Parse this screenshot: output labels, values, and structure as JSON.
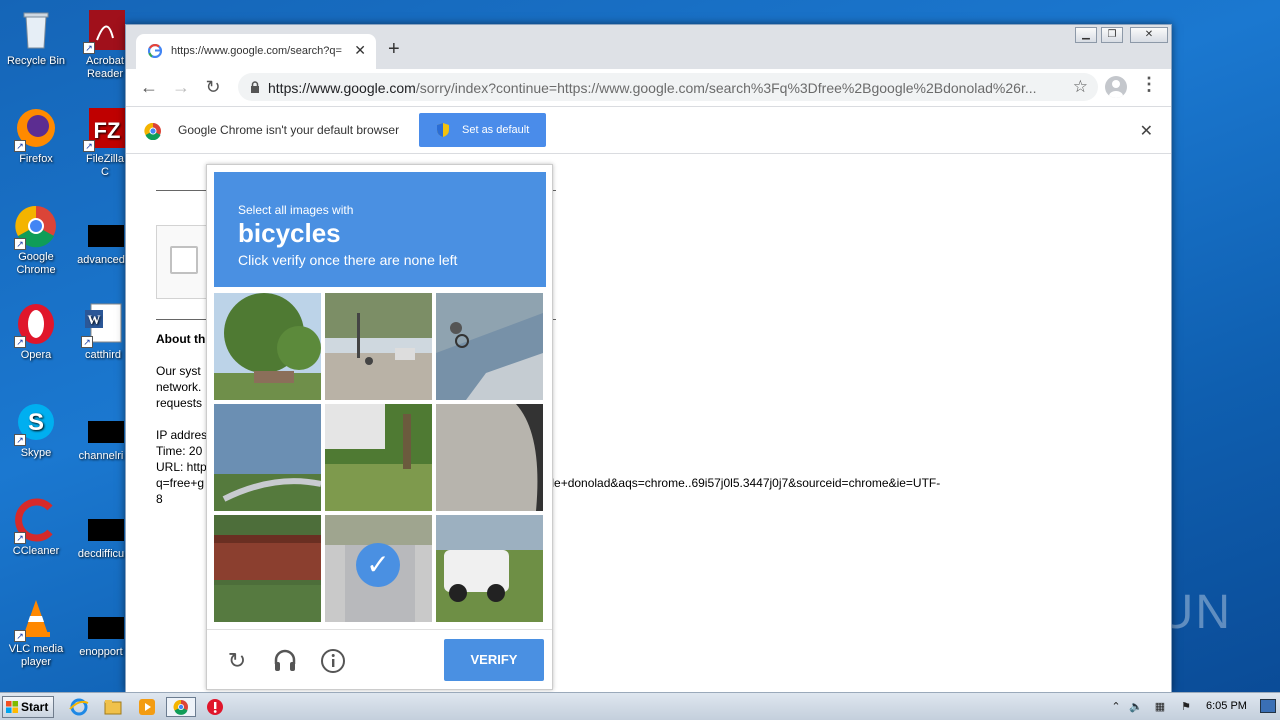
{
  "desktop": {
    "icons": [
      {
        "name": "recycle-bin",
        "label": "Recycle Bin"
      },
      {
        "name": "acrobat-reader",
        "label": "Acrobat Reader"
      },
      {
        "name": "firefox",
        "label": "Firefox"
      },
      {
        "name": "filezilla",
        "label": "FileZilla C"
      },
      {
        "name": "google-chrome",
        "label": "Google Chrome"
      },
      {
        "name": "advanced",
        "label": "advanced"
      },
      {
        "name": "opera",
        "label": "Opera"
      },
      {
        "name": "catthird",
        "label": "catthird"
      },
      {
        "name": "skype",
        "label": "Skype"
      },
      {
        "name": "channelri",
        "label": "channelri"
      },
      {
        "name": "ccleaner",
        "label": "CCleaner"
      },
      {
        "name": "decdifficu",
        "label": "decdifficu"
      },
      {
        "name": "vlc",
        "label": "VLC media player"
      },
      {
        "name": "enopport",
        "label": "enopport"
      }
    ],
    "watermark": "ANY ▷ RUN"
  },
  "browser": {
    "tab_title": "https://www.google.com/search?q=",
    "url_host": "https://www.google.com",
    "url_rest": "/sorry/index?continue=https://www.google.com/search%3Fq%3Dfree%2Bgoogle%2Bdonolad%26r...",
    "infobar_message": "Google Chrome isn't your default browser",
    "set_default_label": "Set as default"
  },
  "page": {
    "about_heading": "About th",
    "para_line1": "Our syst",
    "para_line2": "network.",
    "para_line3": "requests",
    "ip_line": "IP addres",
    "time_line": "Time: 20",
    "url_line": "URL: http",
    "q_line": "q=free+g",
    "q_line_rest": "ogle+donolad&aqs=chrome..69i57j0l5.3447j0j7&sourceid=chrome&ie=UTF-",
    "last_line": "8"
  },
  "captcha": {
    "instruction": "Select all images with",
    "target": "bicycles",
    "subtext": "Click verify once there are none left",
    "verify_label": "VERIFY",
    "selected_tiles": [
      7
    ]
  },
  "taskbar": {
    "start_label": "Start",
    "clock": "6:05 PM"
  }
}
